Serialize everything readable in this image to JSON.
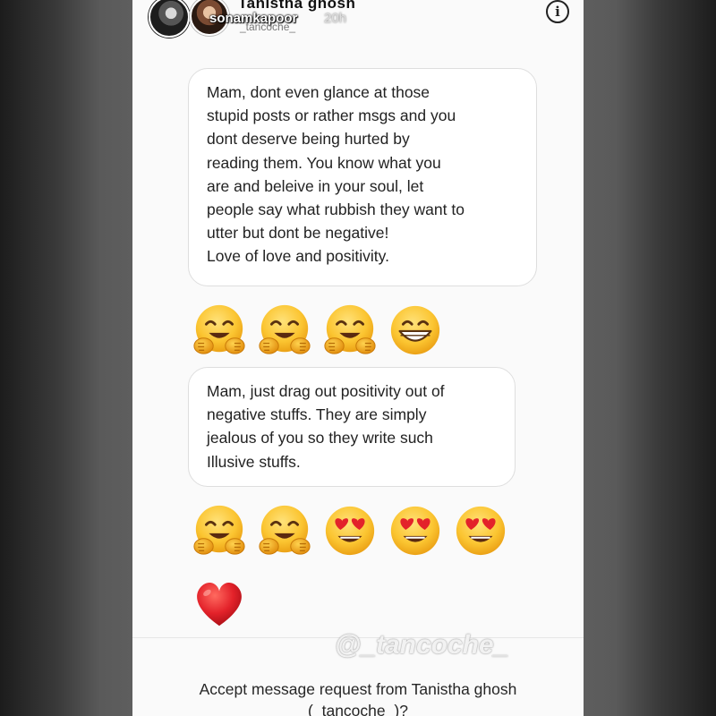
{
  "header": {
    "name": "Tanistha ghosh",
    "story_username": "sonamkapoor",
    "story_time": "20h",
    "handle": "_tancoche_",
    "info_label": "i"
  },
  "messages": [
    {
      "text": "Mam, dont even glance at those\nstupid posts or rather msgs and you\ndont deserve being hurted by\nreading them. You know what you\nare and beleive in your soul, let\npeople say what rubbish they want to\nutter but dont be negative!\nLove of love and positivity."
    },
    {
      "text": "Mam, just drag out positivity out of\nnegative stuffs. They are simply\njealous of you so they write such\nIllusive stuffs."
    }
  ],
  "emoji_rows": [
    [
      "hugging-face-icon",
      "hugging-face-icon",
      "hugging-face-icon",
      "grinning-face-icon"
    ],
    [
      "hugging-face-icon",
      "hugging-face-icon",
      "heart-eyes-face-icon",
      "heart-eyes-face-icon",
      "heart-eyes-face-icon"
    ],
    [
      "red-heart-icon"
    ]
  ],
  "watermark": "@_tancoche_",
  "footer": {
    "request_text": "Accept message request from Tanistha ghosh\n(_tancoche_)?"
  },
  "colors": {
    "background": "#fafafa",
    "bubble_border": "#dedede",
    "text": "#222222",
    "heart": "#e0262c",
    "emoji_yellow": "#f9c232"
  }
}
